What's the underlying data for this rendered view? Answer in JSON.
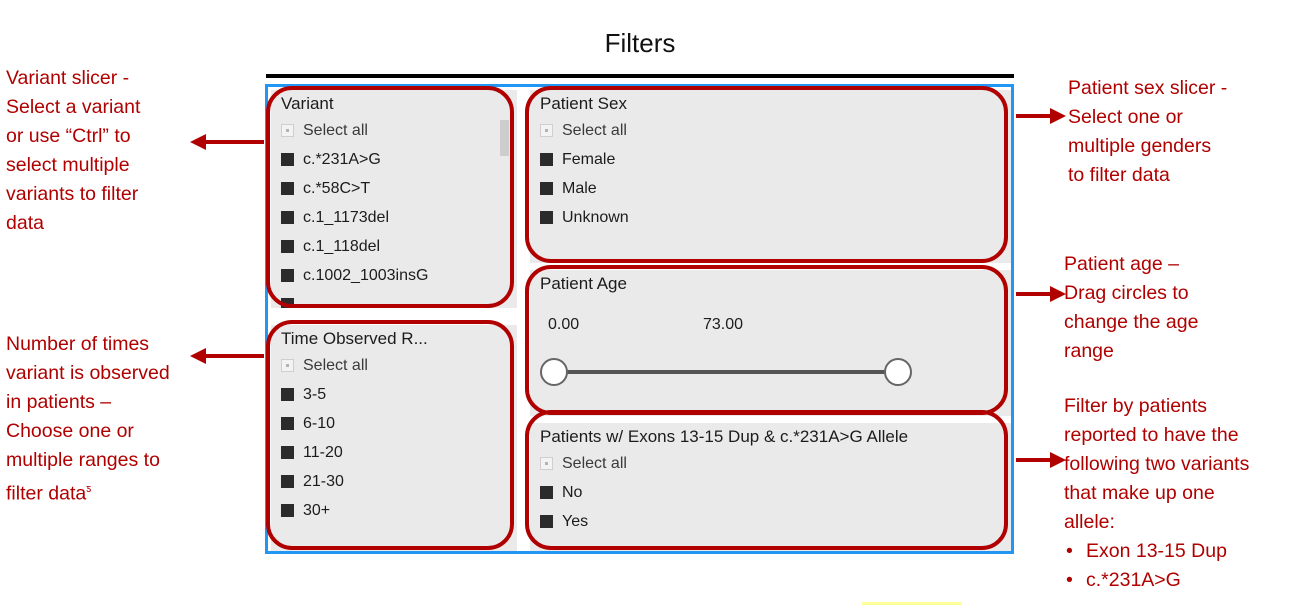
{
  "header": {
    "title": "Filters"
  },
  "slicers": {
    "variant": {
      "title": "Variant",
      "select_all": "Select all",
      "items": [
        "c.*231A>G",
        "c.*58C>T",
        "c.1_1173del",
        "c.1_118del",
        "c.1002_1003insG"
      ],
      "scroll_present": true
    },
    "time_observed": {
      "title": "Time Observed R...",
      "select_all": "Select all",
      "items": [
        "3-5",
        "6-10",
        "11-20",
        "21-30",
        "30+"
      ]
    },
    "patient_sex": {
      "title": "Patient Sex",
      "select_all": "Select all",
      "items": [
        "Female",
        "Male",
        "Unknown"
      ]
    },
    "patient_age": {
      "title": "Patient Age",
      "min_value": "0.00",
      "max_value": "73.00"
    },
    "allele": {
      "title": "Patients w/ Exons 13-15 Dup & c.*231A>G Allele",
      "select_all": "Select all",
      "items": [
        "No",
        "Yes"
      ]
    }
  },
  "annotations": {
    "variant": {
      "lines": [
        "Variant slicer -",
        "Select a variant",
        "or use “Ctrl” to",
        "select multiple",
        "variants to filter",
        "data"
      ]
    },
    "time_observed": {
      "lines": [
        "Number of times",
        "variant is observed",
        "in patients –",
        "Choose one or",
        "multiple ranges to"
      ],
      "last_line": "filter data",
      "last_line_sup": "ƽ"
    },
    "patient_sex": {
      "lines": [
        "Patient sex slicer -",
        "Select one or",
        "multiple genders",
        "to filter data"
      ]
    },
    "patient_age": {
      "lines": [
        "Patient age –",
        "Drag circles to",
        "change the age",
        "range"
      ]
    },
    "allele": {
      "lines": [
        "Filter by patients",
        "reported to have the",
        "following two variants",
        "that make up one",
        "allele:"
      ],
      "bullets": [
        "Exon 13-15 Dup",
        "c.*231A>G"
      ]
    }
  },
  "colors": {
    "annotation_red": "#B00000",
    "canvas_blue": "#2196F3",
    "slicer_bg": "#eaeaea",
    "checkbox_dark": "#2b2b2b",
    "bottom_rule": "#ffff99"
  }
}
